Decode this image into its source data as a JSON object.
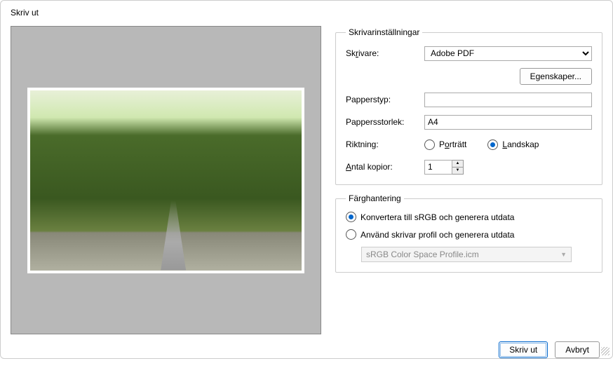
{
  "title": "Skriv ut",
  "printerSettings": {
    "legend": "Skrivarinställningar",
    "printerLabel_pre": "Sk",
    "printerLabel_u": "r",
    "printerLabel_post": "ivare:",
    "printerValue": "Adobe PDF",
    "propertiesBtn": "Egenskaper...",
    "paperTypeLabel": "Papperstyp:",
    "paperTypeValue": "",
    "paperSizeLabel": "Pappersstorlek:",
    "paperSizeValue": "A4",
    "orientationLabel": "Riktning:",
    "portrait_pre": "P",
    "portrait_u": "o",
    "portrait_post": "rträtt",
    "landscape_pre": "",
    "landscape_u": "L",
    "landscape_post": "andskap",
    "copiesLabel_u": "A",
    "copiesLabel_post": "ntal kopior:",
    "copiesValue": "1"
  },
  "colorMgmt": {
    "legend": "Färghantering",
    "option1": "Konvertera till sRGB och generera utdata",
    "option2": "Använd skrivar profil och generera utdata",
    "profile": "sRGB Color Space Profile.icm"
  },
  "footer": {
    "print": "Skriv ut",
    "cancel": "Avbryt"
  }
}
